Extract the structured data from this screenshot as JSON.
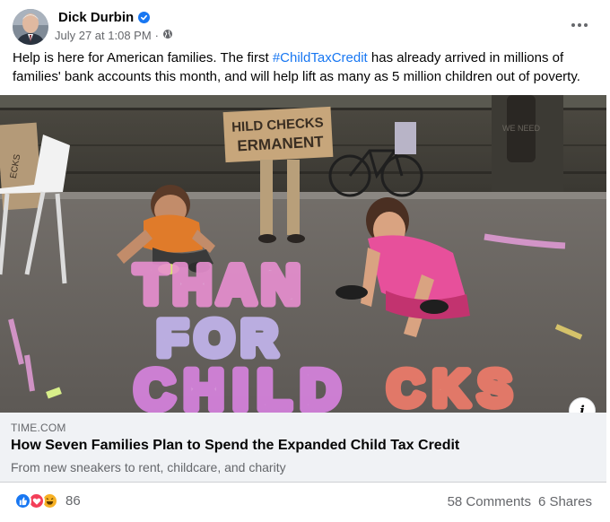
{
  "post": {
    "author": "Dick Durbin",
    "timestamp": "July 27 at 1:08 PM",
    "meta_separator": "·",
    "audience_icon": "globe-icon",
    "verified_icon": "verified-badge-icon",
    "more_icon": "more-options-icon",
    "text_before": "Help is here for American families. The first ",
    "hashtag": "#ChildTaxCredit",
    "text_after": " has already arrived in millions of families' bank accounts this month, and will help lift as many as 5 million children out of poverty."
  },
  "photo": {
    "sign_text_line1": "HILD CHECKS",
    "sign_text_line2": "ERMANENT",
    "left_sign_text": "ECKS",
    "tree_text": "WE NEED",
    "chalk_line1": "THAN",
    "chalk_line2": "FOR",
    "chalk_line3": "CHILD",
    "chalk_line4": "CKS",
    "info_label": "i"
  },
  "link_preview": {
    "domain": "TIME.COM",
    "title": "How Seven Families Plan to Spend the Expanded Child Tax Credit",
    "subtitle": "From new sneakers to rent, childcare, and charity"
  },
  "engagement": {
    "reaction_icons": [
      "like-reaction-icon",
      "love-reaction-icon",
      "haha-reaction-icon"
    ],
    "reaction_count": "86",
    "comments": "58 Comments",
    "shares": "6 Shares"
  },
  "colors": {
    "accent": "#1877f2",
    "secondary_text": "#65676b",
    "card_bg": "#f0f2f5",
    "love": "#f33e58",
    "haha": "#f7b125"
  }
}
